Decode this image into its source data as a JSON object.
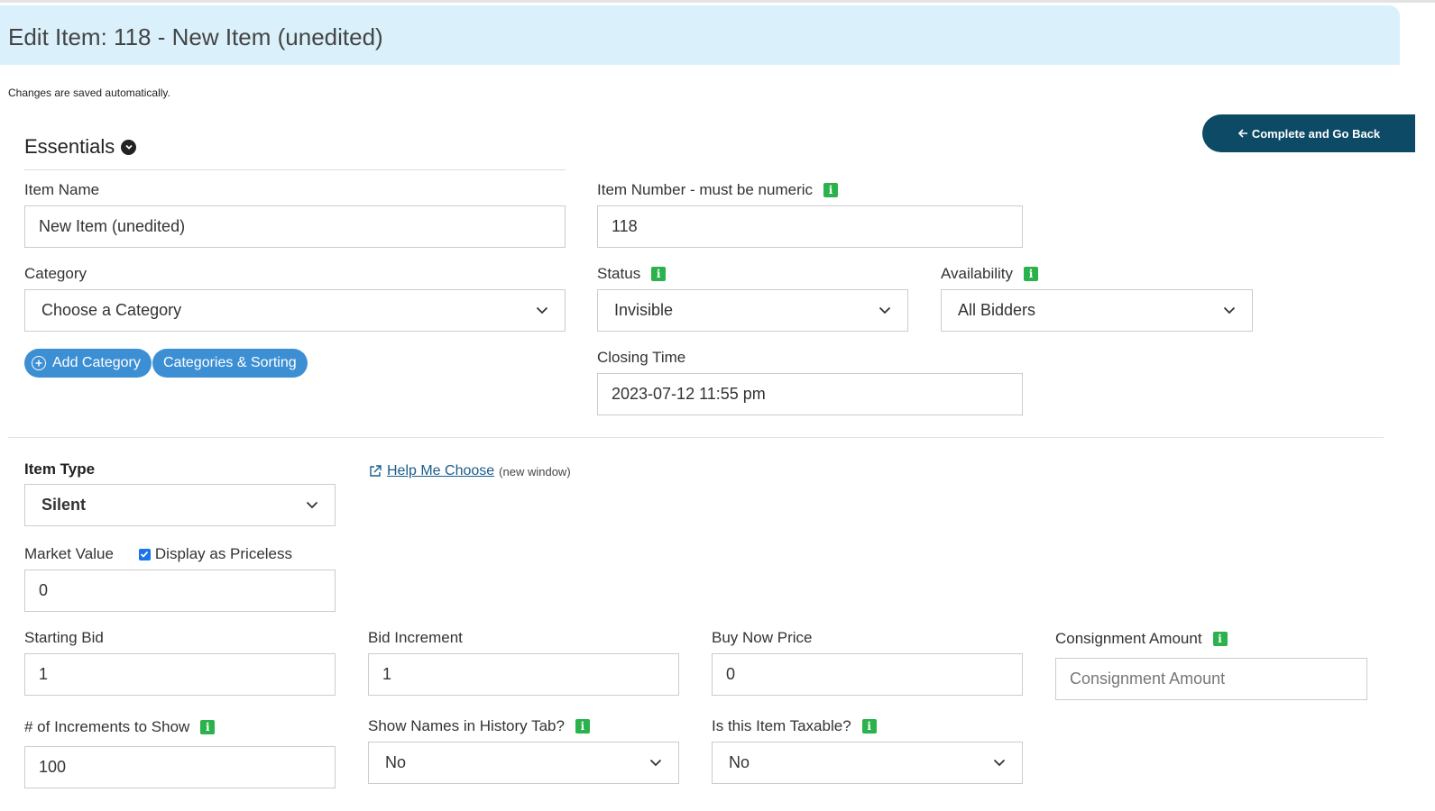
{
  "header": {
    "title": "Edit Item: 118 - New Item (unedited)",
    "note": "Changes are saved automatically."
  },
  "back_button": {
    "label": "Complete and Go Back",
    "icon": "arrow-left-icon"
  },
  "essentials": {
    "title": "Essentials",
    "item_name": {
      "label": "Item Name",
      "value": "New Item (unedited)"
    },
    "item_number": {
      "label": "Item Number - must be numeric",
      "value": "118"
    },
    "category": {
      "label": "Category",
      "selected": "Choose a Category"
    },
    "status": {
      "label": "Status",
      "selected": "Invisible"
    },
    "availability": {
      "label": "Availability",
      "selected": "All Bidders"
    },
    "add_category_label": "Add Category",
    "categories_sorting_label": "Categories & Sorting",
    "closing_time": {
      "label": "Closing Time",
      "value": "2023-07-12 11:55 pm"
    }
  },
  "pricing": {
    "item_type": {
      "label": "Item Type",
      "selected": "Silent"
    },
    "help": {
      "link": "Help Me Choose",
      "suffix": "(new window)"
    },
    "market_value": {
      "label": "Market Value",
      "value": "0"
    },
    "priceless": {
      "label": "Display as Priceless",
      "checked": true
    },
    "starting_bid": {
      "label": "Starting Bid",
      "value": "1"
    },
    "bid_increment": {
      "label": "Bid Increment",
      "value": "1"
    },
    "buy_now": {
      "label": "Buy Now Price",
      "value": "0"
    },
    "consignment": {
      "label": "Consignment Amount",
      "value": "",
      "placeholder": "Consignment Amount"
    },
    "increments_show": {
      "label": "# of Increments to Show",
      "value": "100"
    },
    "show_names": {
      "label": "Show Names in History Tab?",
      "selected": "No"
    },
    "taxable": {
      "label": "Is this Item Taxable?",
      "selected": "No"
    }
  },
  "colors": {
    "header_bg": "#daf1fb",
    "back_button_bg": "#0d4a66",
    "pill_bg": "#3d8fd4",
    "info_icon": "#2bb24c",
    "link": "#1a5d8c"
  }
}
